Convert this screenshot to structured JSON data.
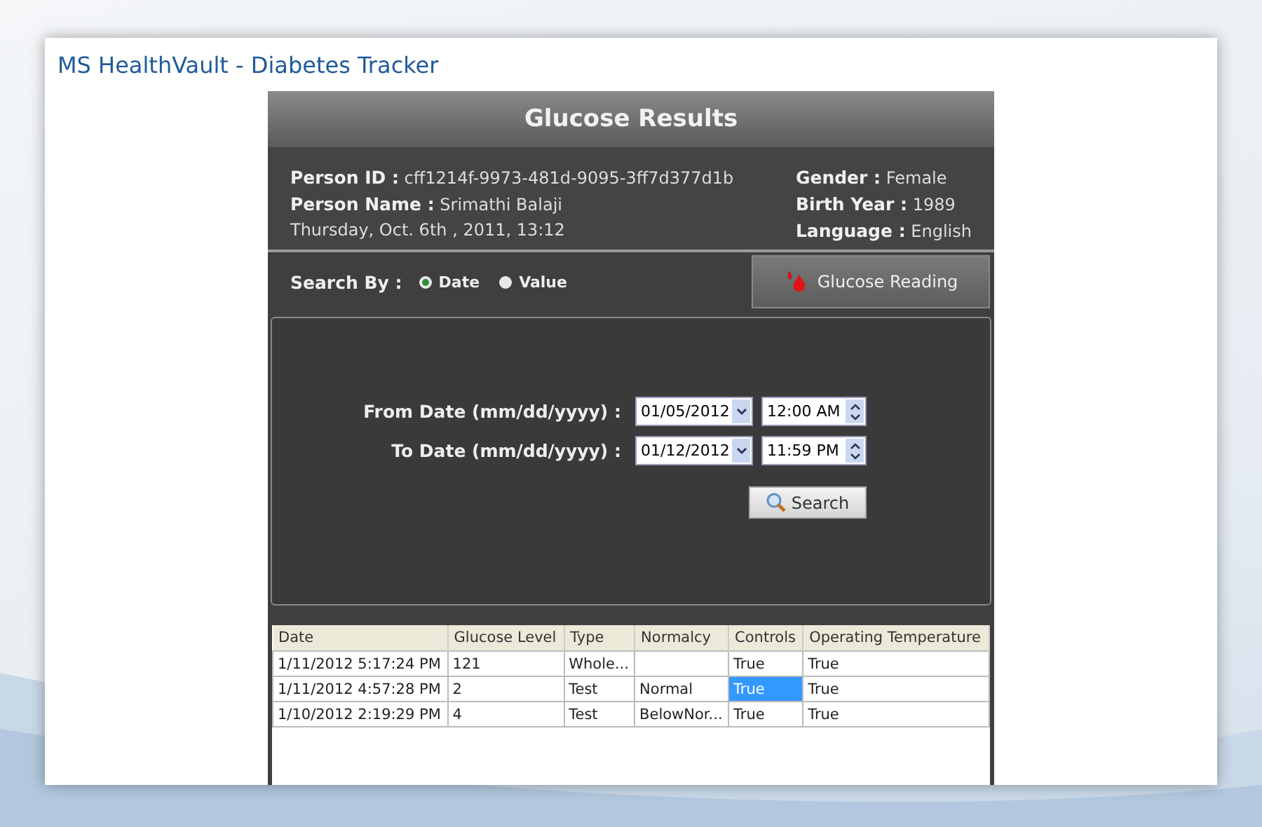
{
  "page_title": "MS HealthVault - Diabetes Tracker",
  "panel": {
    "title": "Glucose Results",
    "person": [
      {
        "label": "Person ID :",
        "value": "cff1214f-9973-481d-9095-3ff7d377d1b"
      },
      {
        "label": "Person Name :",
        "value": "Srimathi Balaji"
      }
    ],
    "date_line": "Thursday, Oct. 6th , 2011,  13:12",
    "details": [
      {
        "label": "Gender :",
        "value": "Female"
      },
      {
        "label": "Birth Year :",
        "value": "1989"
      },
      {
        "label": "Language :",
        "value": "English"
      }
    ],
    "search_by": {
      "label": "Search By :",
      "options": [
        {
          "label": "Date",
          "selected": true
        },
        {
          "label": "Value",
          "selected": false
        }
      ]
    },
    "glucose_button": "Glucose Reading",
    "filters": [
      {
        "label": "From Date (mm/dd/yyyy) :",
        "date": "01/05/2012",
        "time": "12:00 AM"
      },
      {
        "label": "To Date (mm/dd/yyyy) :",
        "date": "01/12/2012",
        "time": "11:59 PM"
      }
    ],
    "search_button": "Search",
    "table": {
      "columns": [
        "Date",
        "Glucose Level",
        "Type",
        "Normalcy",
        "Controls",
        "Operating Temperature"
      ],
      "rows": [
        {
          "cells": [
            {
              "text": "1/11/2012 5:17:24 PM",
              "selected": false
            },
            {
              "text": "121",
              "selected": false
            },
            {
              "text": "Whole...",
              "selected": false
            },
            {
              "selected": false
            },
            {
              "text": "True",
              "selected": false
            },
            {
              "text": "True",
              "selected": false
            }
          ]
        },
        {
          "cells": [
            {
              "text": "1/11/2012 4:57:28 PM",
              "selected": false
            },
            {
              "text": "2",
              "selected": false
            },
            {
              "text": "Test",
              "selected": false
            },
            {
              "text": "Normal",
              "selected": false
            },
            {
              "text": "True",
              "selected": true
            },
            {
              "text": "True",
              "selected": false
            }
          ]
        },
        {
          "cells": [
            {
              "text": "1/10/2012 2:19:29 PM",
              "selected": false
            },
            {
              "text": "4",
              "selected": false
            },
            {
              "text": "Test",
              "selected": false
            },
            {
              "text": "BelowNor...",
              "selected": false
            },
            {
              "text": "True",
              "selected": false
            },
            {
              "text": "True",
              "selected": false
            }
          ]
        }
      ]
    }
  }
}
